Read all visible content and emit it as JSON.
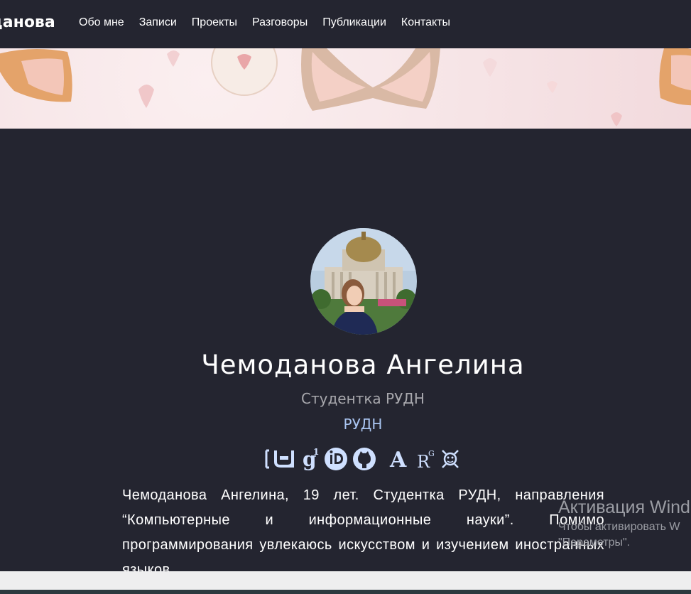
{
  "navbar": {
    "brand": "данова",
    "links": [
      "Обо мне",
      "Записи",
      "Проекты",
      "Разговоры",
      "Публикации",
      "Контакты"
    ]
  },
  "profile": {
    "name": "Чемоданова Ангелина",
    "role": "Студентка РУДН",
    "organization": "РУДН",
    "bio": "Чемоданова Ангелина, 19 лет. Студентка РУДН, направления “Компьютерные и информационные науки”. Помимо программирования увлекаюсь искусством и изучением иностранных языков."
  },
  "social_icons": [
    "arxiv-icon",
    "google-scholar-icon",
    "orcid-icon",
    "github-icon",
    "academia-icon",
    "researchgate-icon",
    "kaggle-icon"
  ],
  "colors": {
    "background": "#242530",
    "link": "#a9c4f0",
    "muted": "#a8a8ad",
    "icon": "#cfe0ff"
  },
  "windows_activation": {
    "title": "Активация Wind",
    "subtitle_line1": "Чтобы активировать W",
    "subtitle_line2": "\"Параметры\"."
  }
}
